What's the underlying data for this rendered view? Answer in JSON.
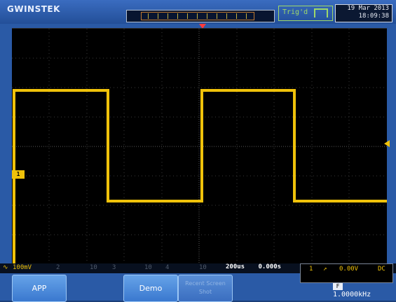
{
  "header": {
    "brand": "GWINSTEK",
    "trigger_status": "Trig'd",
    "date": "19 Mar 2013",
    "time": "18:09:38"
  },
  "screen": {
    "ch1_marker": "1",
    "frequency_label": "F",
    "frequency_value": "1.0000kHz"
  },
  "status_bar": {
    "ch1_scale": "100mV",
    "ch2_number": "2",
    "ch2_scale": "10",
    "ch3_number": "3",
    "ch3_scale": "10",
    "ch4_number": "4",
    "ch4_scale": "10",
    "timebase": "200us",
    "h_position": "0.000s",
    "trigger_source": "1",
    "trigger_level": "0.00V",
    "trigger_coupling": "DC"
  },
  "softkeys": {
    "app": "APP",
    "demo": "Demo",
    "disabled_label": "Recent Screen Shot"
  },
  "colors": {
    "accent": "#f0c20a",
    "screen_bg": "#000000",
    "frame": "#2a5aa6"
  }
}
